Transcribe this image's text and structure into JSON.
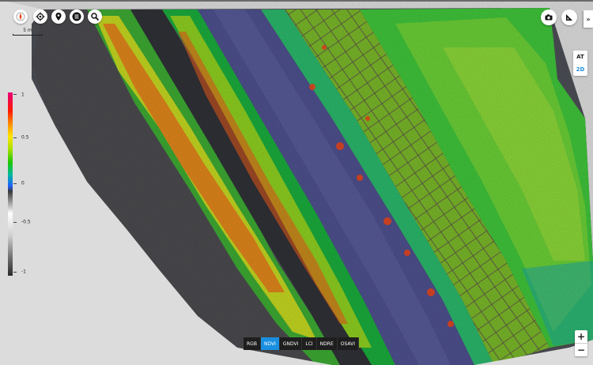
{
  "toolbar": {
    "buttons": [
      {
        "name": "compass-icon"
      },
      {
        "name": "crosshair-icon"
      },
      {
        "name": "map-pin-icon"
      },
      {
        "name": "list-icon"
      },
      {
        "name": "search-icon"
      }
    ]
  },
  "scale": {
    "label": "5 m"
  },
  "legend": {
    "ticks": [
      "1",
      "0.5",
      "0",
      "-0.5",
      "-1"
    ],
    "tick_values": [
      1,
      0.5,
      0,
      -0.5,
      -1
    ]
  },
  "right_tools": {
    "camera": "camera-icon",
    "measure": "ruler-triangle-icon",
    "expand_label": "»"
  },
  "view": {
    "at_label": "AT",
    "d2_label": "2D",
    "active": "2D"
  },
  "bands": {
    "labels": [
      "RGB",
      "NDVI",
      "GNDVI",
      "LCI",
      "NDRE",
      "OSAVI"
    ],
    "active": "NDVI",
    "active_color": "#1a8fe0"
  },
  "zoom": {
    "in_label": "+",
    "out_label": "−"
  }
}
